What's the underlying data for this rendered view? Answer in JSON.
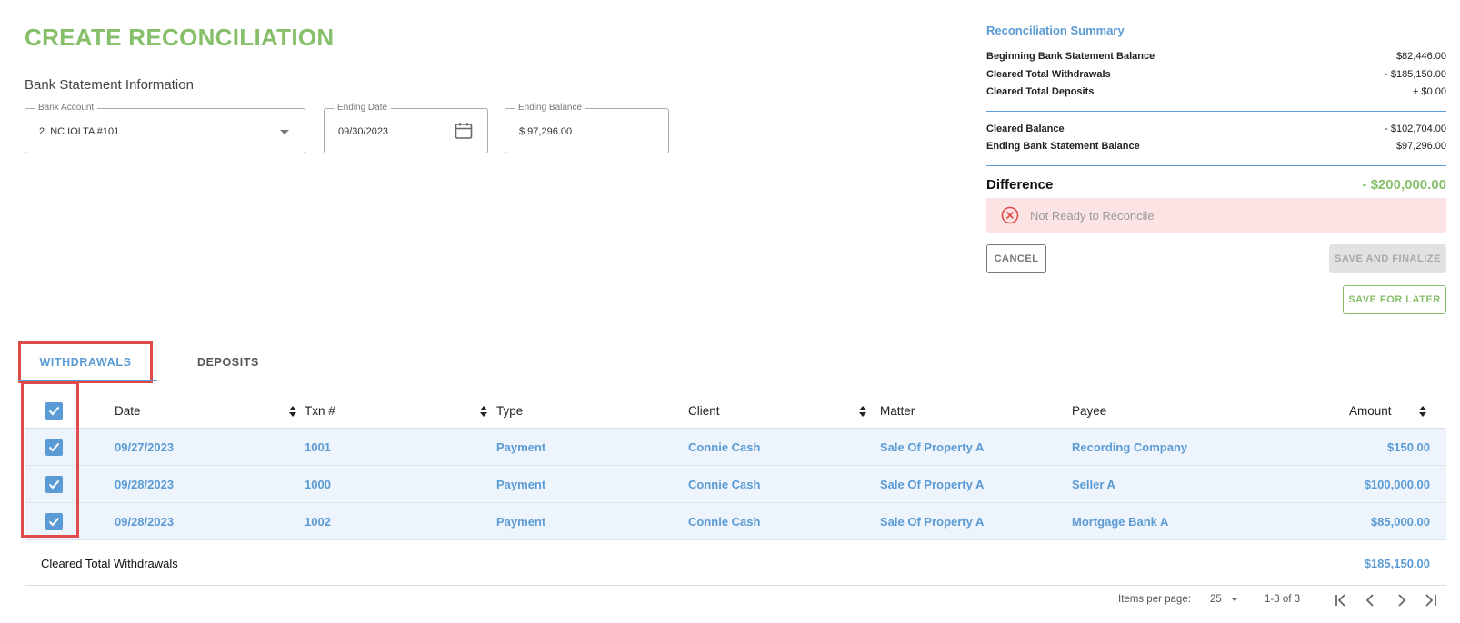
{
  "page": {
    "title": "CREATE RECONCILIATION",
    "section_title": "Bank Statement Information"
  },
  "fields": {
    "bank_account": {
      "label": "Bank Account",
      "value": "2. NC IOLTA #101"
    },
    "ending_date": {
      "label": "Ending Date",
      "value": "09/30/2023"
    },
    "ending_balance": {
      "label": "Ending Balance",
      "value": "$ 97,296.00"
    }
  },
  "summary": {
    "title": "Reconciliation Summary",
    "rows": [
      {
        "label": "Beginning Bank Statement Balance",
        "value": "$82,446.00"
      },
      {
        "label": "Cleared Total Withdrawals",
        "value": "- $185,150.00"
      },
      {
        "label": "Cleared Total Deposits",
        "value": "+ $0.00"
      }
    ],
    "rows2": [
      {
        "label": "Cleared Balance",
        "value": "- $102,704.00"
      },
      {
        "label": "Ending Bank Statement Balance",
        "value": "$97,296.00"
      }
    ],
    "difference_label": "Difference",
    "difference_value": "- $200,000.00",
    "alert_text": "Not Ready to Reconcile"
  },
  "buttons": {
    "cancel": "CANCEL",
    "save_finalize": "SAVE AND FINALIZE",
    "save_later": "SAVE FOR LATER"
  },
  "tabs": {
    "withdrawals": "WITHDRAWALS",
    "deposits": "DEPOSITS"
  },
  "table": {
    "headers": {
      "date": "Date",
      "txn": "Txn #",
      "type": "Type",
      "client": "Client",
      "matter": "Matter",
      "payee": "Payee",
      "amount": "Amount"
    },
    "rows": [
      {
        "date": "09/27/2023",
        "txn": "1001",
        "type": "Payment",
        "client": "Connie Cash",
        "matter": "Sale Of Property A",
        "payee": "Recording Company",
        "amount": "$150.00"
      },
      {
        "date": "09/28/2023",
        "txn": "1000",
        "type": "Payment",
        "client": "Connie Cash",
        "matter": "Sale Of Property A",
        "payee": "Seller A",
        "amount": "$100,000.00"
      },
      {
        "date": "09/28/2023",
        "txn": "1002",
        "type": "Payment",
        "client": "Connie Cash",
        "matter": "Sale Of Property A",
        "payee": "Mortgage Bank A",
        "amount": "$85,000.00"
      }
    ],
    "footer_label": "Cleared Total Withdrawals",
    "footer_value": "$185,150.00"
  },
  "pagination": {
    "items_per_page_label": "Items per page:",
    "items_per_page_value": "25",
    "range": "1-3 of 3"
  },
  "colors": {
    "accent_green": "#86bf6a",
    "accent_blue": "#5b9bd5",
    "highlight_red": "#e04a4a",
    "alert_bg": "#fde4e4"
  }
}
